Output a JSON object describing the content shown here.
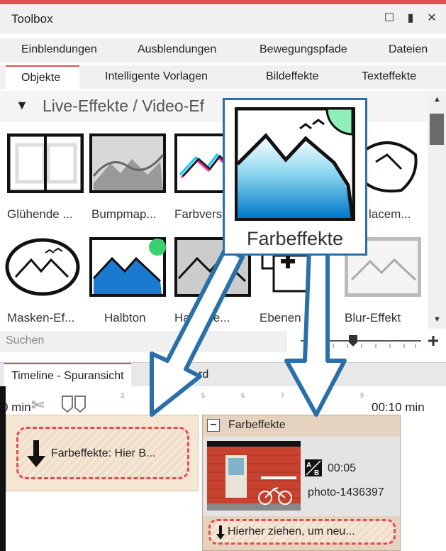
{
  "window": {
    "title": "Toolbox"
  },
  "tabs_row1": [
    "Einblendungen",
    "Ausblendungen",
    "Bewegungspfade",
    "Dateien"
  ],
  "tabs_row2": [
    "Objekte",
    "Intelligente Vorlagen",
    "Bildeffekte",
    "Texteffekte"
  ],
  "section": {
    "title": "Live-Effekte / Video-Ef"
  },
  "effects_row1": [
    "Glühende ...",
    "Bumpmap...",
    "Farbvers",
    "lacem..."
  ],
  "effects_row2": [
    "Masken-Ef...",
    "Halbton",
    "Ha   on, e...",
    "Ebenen     ...",
    "Blur-Effekt"
  ],
  "search": {
    "placeholder": "Suchen"
  },
  "popup": {
    "label": "Farbeffekte"
  },
  "timeline": {
    "tab_active": "Timeline - Spuransicht",
    "tab_other": "rd",
    "time_left": "0 min",
    "time_right": "00:10 min",
    "ticks": [
      "3",
      "5",
      "6",
      "7",
      "9"
    ]
  },
  "dropzone_left": {
    "text": "Farbeffekte: Hier B..."
  },
  "effect_block": {
    "title": "Farbeffekte",
    "duration": "00:05",
    "file": "photo-1436397",
    "ab_icon": "AB",
    "drop_text": "Hierher ziehen, um neu..."
  },
  "colors": {
    "accent": "#e05050",
    "arrow": "#2a6fa8",
    "popup_border": "#2a6fa8"
  }
}
